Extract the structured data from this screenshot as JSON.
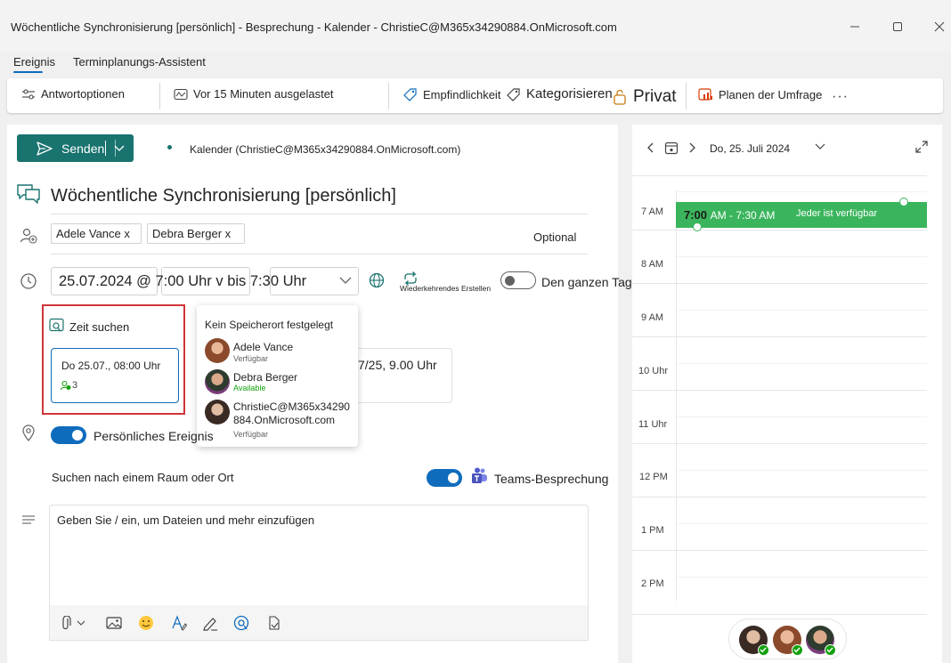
{
  "window": {
    "title": "Wöchentliche Synchronisierung [persönlich] - Besprechung - Kalender - ChristieC@M365x34290884.OnMicrosoft.com"
  },
  "tabs": [
    {
      "label": "Ereignis",
      "active": true
    },
    {
      "label": "Terminplanungs-Assistent",
      "active": false
    }
  ],
  "ribbon": {
    "response_options": "Antwortoptionen",
    "busy_status": "Vor 15 Minuten ausgelastet",
    "sensitivity": "Empfindlichkeit",
    "categorize": "Kategorisieren",
    "private": "Privat",
    "schedule_poll": "Planen der Umfrage"
  },
  "compose": {
    "send_label": "Senden",
    "calendar_label": "Kalender (ChristieC@M365x34290884.OnMicrosoft.com)",
    "subject": "Wöchentliche Synchronisierung [persönlich]",
    "attendees": [
      "Adele Vance x",
      "Debra Berger x"
    ],
    "optional_label": "Optional",
    "date": "25.07.2024 @ 7:00 Uhr v bis 7:30 Uhr",
    "recurring_label": "Wiederkehrendes Erstellen",
    "all_day_label": "Den ganzen Tag",
    "find_time_label": "Zeit suchen",
    "suggestion_time": "Do 25.07., 08:00 Uhr",
    "suggestion_count": "3",
    "second_suggestion": "7/25, 9.00 Uhr",
    "personal_event_label": "Persönliches Ereignis",
    "location_placeholder": "Suchen nach einem Raum oder Ort",
    "teams_label": "Teams-Besprechung",
    "body_placeholder": "Geben Sie / ein, um Dateien und mehr einzufügen"
  },
  "popup": {
    "header": "Kein Speicherort festgelegt",
    "people": [
      {
        "name": "Adele Vance",
        "status": "Verfügbar",
        "status_color": "#616161"
      },
      {
        "name": "Debra Berger",
        "status": "Available",
        "status_color": "#13a10e"
      },
      {
        "name": "ChristieC@M365x34290",
        "name2": "884.OnMicrosoft.com",
        "status": "Verfügbar",
        "status_color": "#616161"
      }
    ]
  },
  "calendar": {
    "date_label": "Do, 25. Juli 2024",
    "hours": [
      "7 AM",
      "8 AM",
      "9 AM",
      "10 Uhr",
      "11 Uhr",
      "12 PM",
      "1 PM",
      "2 PM"
    ],
    "event": {
      "start_bold": "7:00",
      "range_rest": "AM - 7:30 AM",
      "note": "Jeder ist verfügbar",
      "color": "#3bb55d"
    }
  },
  "colors": {
    "accent": "#0f6cbd",
    "send": "#19736f",
    "find_time_highlight": "#d13438"
  }
}
